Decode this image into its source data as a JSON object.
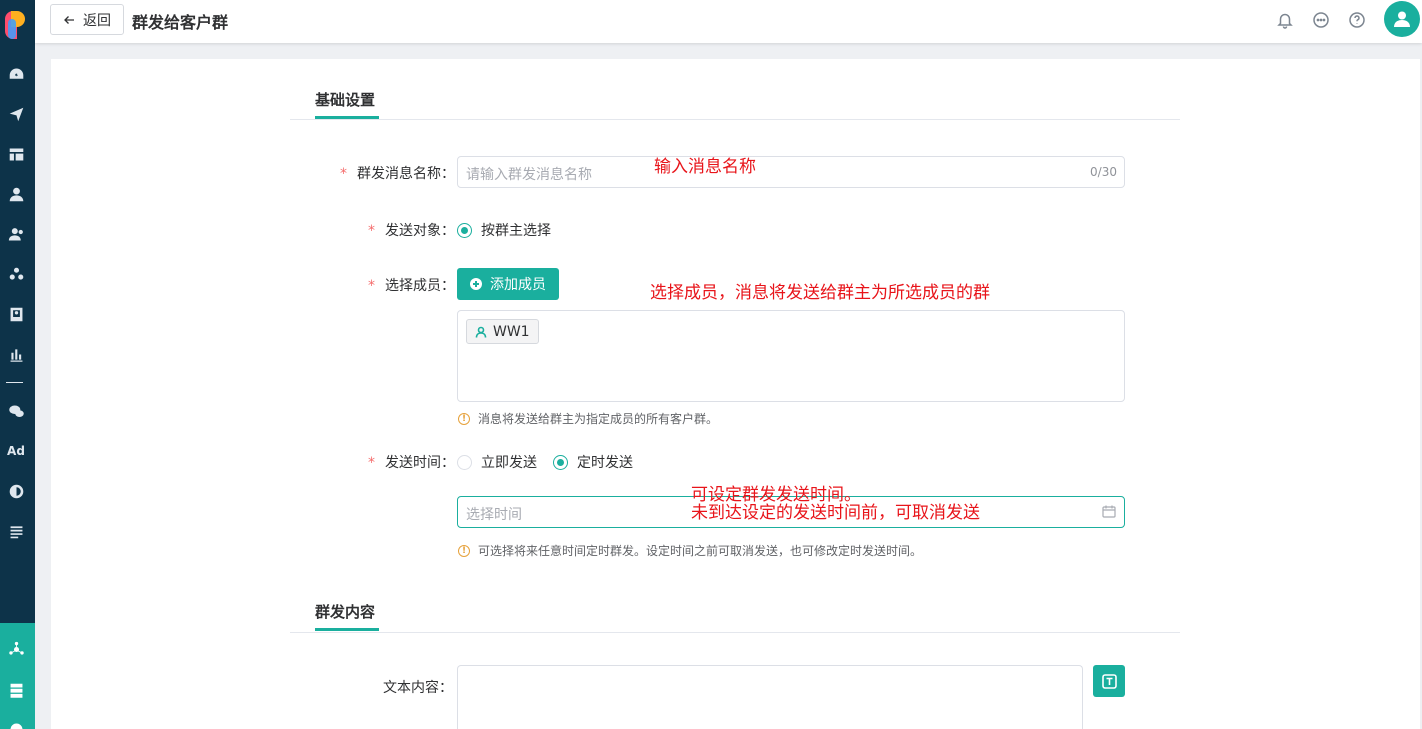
{
  "header": {
    "back_label": "返回",
    "title": "群发给客户群"
  },
  "sidebar": {
    "icons": [
      "dashboard-icon",
      "send-icon",
      "layout-icon",
      "user-icon",
      "contacts-icon",
      "group-icon",
      "badge-icon",
      "chart-icon",
      "wechat-icon",
      "ad-icon",
      "circle-icon",
      "list-icon",
      "network-icon",
      "server-icon",
      "settings-icon"
    ],
    "ad_text": "Ad"
  },
  "sections": {
    "basic": "基础设置",
    "content": "群发内容"
  },
  "form": {
    "name_label": "群发消息名称：",
    "name_placeholder": "请输入群发消息名称",
    "name_count": "0/30",
    "target_label": "发送对象：",
    "target_option": "按群主选择",
    "members_label": "选择成员：",
    "add_member_button": "添加成员",
    "member_tag": "WW1",
    "members_hint": "消息将发送给群主为指定成员的所有客户群。",
    "time_label": "发送时间：",
    "time_option_now": "立即发送",
    "time_option_scheduled": "定时发送",
    "time_selected": "定时发送",
    "time_placeholder": "选择时间",
    "time_hint": "可选择将来任意时间定时群发。设定时间之前可取消发送，也可修改定时发送时间。",
    "text_label": "文本内容："
  },
  "annotations": {
    "name": "输入消息名称",
    "members": "选择成员，消息将发送给群主为所选成员的群",
    "time_line1": "可设定群发发送时间。",
    "time_line2": "未到达设定的发送时间前，可取消发送"
  },
  "colors": {
    "accent": "#1aaf9e",
    "sidebar": "#0d3349",
    "required": "#f56c6c",
    "annotation": "#e8141a",
    "warning": "#e6a23c"
  }
}
